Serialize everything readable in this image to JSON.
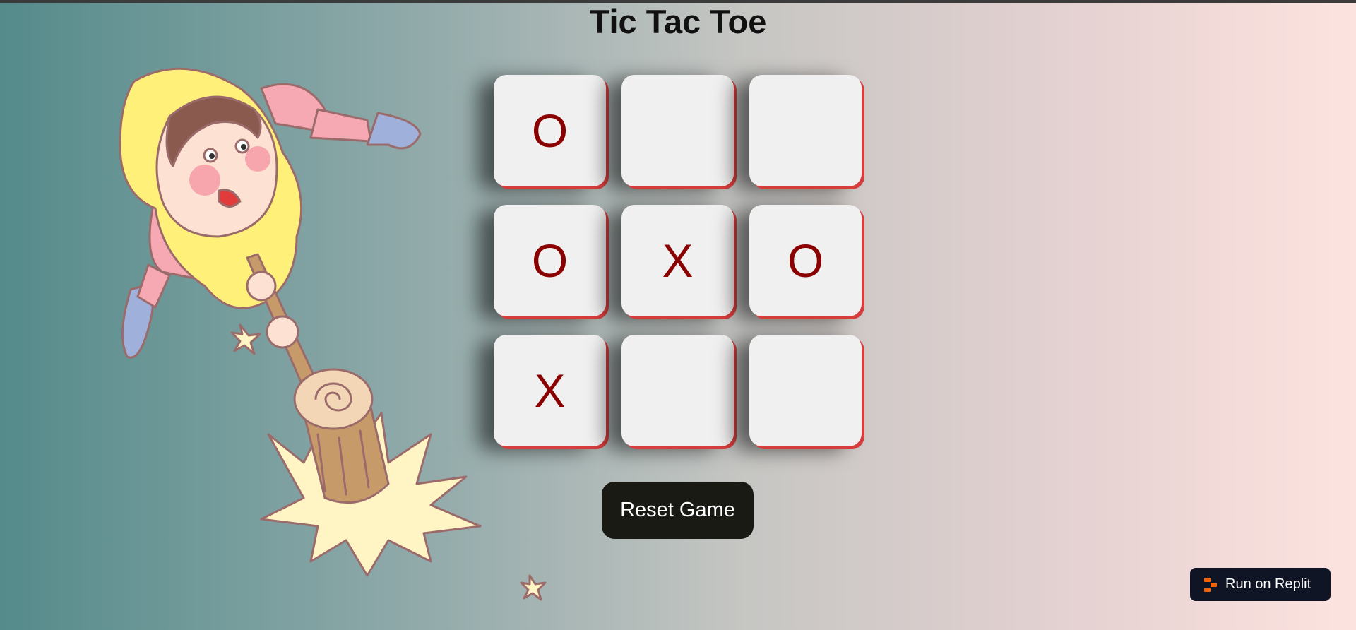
{
  "page": {
    "title": "Tic Tac Toe"
  },
  "board": {
    "cells": [
      "O",
      "",
      "",
      "O",
      "X",
      "O",
      "X",
      "",
      ""
    ],
    "mark_color": "#8b0000",
    "cell_color": "#f0f0f0",
    "edge_color": "#d63d3d"
  },
  "controls": {
    "reset_label": "Reset Game"
  },
  "badge": {
    "label": "Run on Replit",
    "icon": "replit-logo-icon"
  },
  "illustration": {
    "name": "cartoon-man-with-mallet"
  }
}
